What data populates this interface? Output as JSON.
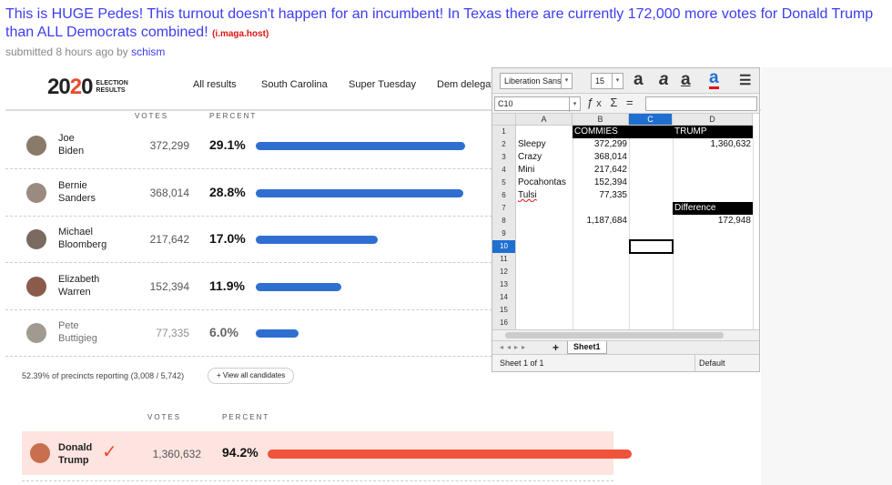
{
  "post": {
    "title": "This is HUGE Pedes! This turnout doesn't happen for an incumbent! In Texas there are currently 172,000 more votes for Donald Trump than ALL Democrats combined!",
    "domain": "(i.maga.host)",
    "submitted": "submitted 8 hours ago by",
    "author": "schism"
  },
  "results": {
    "logo_num": "2020",
    "logo_sub_1": "ELECTION",
    "logo_sub_2": "RESULTS",
    "nav": [
      "All results",
      "South Carolina",
      "Super Tuesday",
      "Dem delegate"
    ],
    "col_votes": "VOTES",
    "col_percent": "PERCENT",
    "candidates": [
      {
        "first": "Joe",
        "last": "Biden",
        "votes": "372,299",
        "pct": "29.1%",
        "share": 0.291
      },
      {
        "first": "Bernie",
        "last": "Sanders",
        "votes": "368,014",
        "pct": "28.8%",
        "share": 0.288
      },
      {
        "first": "Michael",
        "last": "Bloomberg",
        "votes": "217,642",
        "pct": "17.0%",
        "share": 0.17
      },
      {
        "first": "Elizabeth",
        "last": "Warren",
        "votes": "152,394",
        "pct": "11.9%",
        "share": 0.119
      },
      {
        "first": "Pete",
        "last": "Buttigieg",
        "votes": "77,335",
        "pct": "6.0%",
        "share": 0.06
      }
    ],
    "precincts": "52.39% of precincts reporting (3,008 / 5,742)",
    "view_all": "+ View all candidates",
    "gop_col_votes": "VOTES",
    "gop_col_percent": "PERCENT",
    "trump": {
      "first": "Donald",
      "last": "Trump",
      "votes": "1,360,632",
      "pct": "94.2%",
      "share": 0.942
    }
  },
  "sheet": {
    "font_name": "Liberation Sans",
    "font_size": "15",
    "cell_ref": "C10",
    "columns": [
      "A",
      "B",
      "C",
      "D"
    ],
    "rows": [
      "1",
      "2",
      "3",
      "4",
      "5",
      "6",
      "7",
      "8",
      "9",
      "10",
      "11",
      "12",
      "13",
      "14",
      "15",
      "16"
    ],
    "header_b": "COMMIES",
    "header_d": "TRUMP",
    "names": [
      "Sleepy",
      "Crazy",
      "Mini",
      "Pocahontas",
      "Tulsi"
    ],
    "values": [
      "372,299",
      "368,014",
      "217,642",
      "152,394",
      "77,335"
    ],
    "trump_total": "1,360,632",
    "difference_label": "Difference",
    "difference": "172,948",
    "commies_total": "1,187,684",
    "tab": "Sheet1",
    "status_left": "Sheet 1 of 1",
    "status_right": "Default"
  },
  "colors": {
    "dem_bar": "#2f6fd0",
    "trump_bar": "#f0533a",
    "link": "#3d3df0",
    "accent": "#e84b2e"
  }
}
